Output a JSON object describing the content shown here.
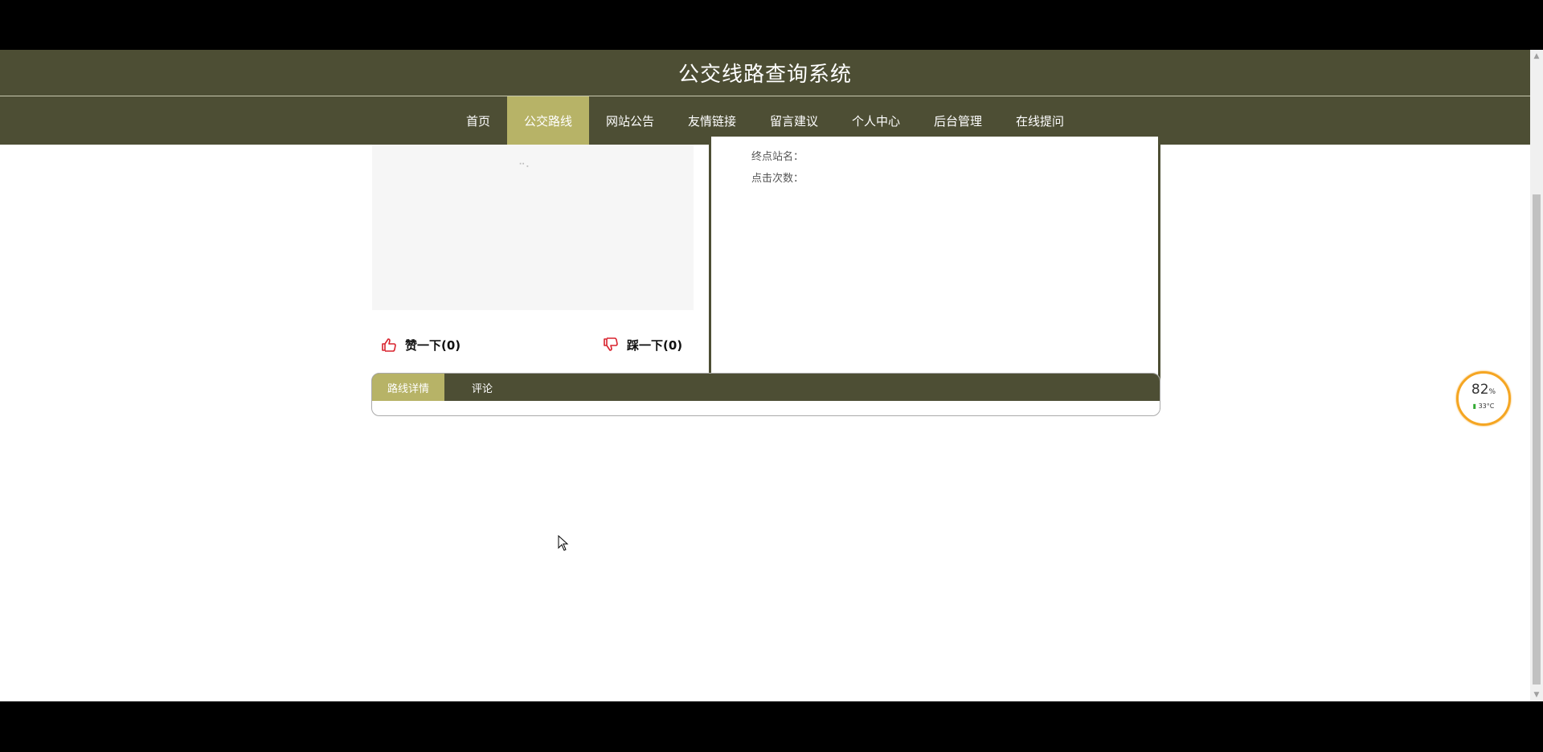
{
  "site": {
    "title": "公交线路查询系统"
  },
  "nav": {
    "items": [
      {
        "label": "首页"
      },
      {
        "label": "公交路线"
      },
      {
        "label": "网站公告"
      },
      {
        "label": "友情链接"
      },
      {
        "label": "留言建议"
      },
      {
        "label": "个人中心"
      },
      {
        "label": "后台管理"
      },
      {
        "label": "在线提问"
      }
    ],
    "active_index": 1
  },
  "votes": {
    "up_label": "赞一下(0)",
    "down_label": "踩一下(0)"
  },
  "info": {
    "end_station_label": "终点站名：",
    "click_count_label": "点击次数："
  },
  "tabs": {
    "items": [
      {
        "label": "路线详情"
      },
      {
        "label": "评论"
      }
    ]
  },
  "battery_widget": {
    "percent": "82",
    "percent_unit": "%",
    "temperature": "33°C"
  },
  "colors": {
    "header_bg": "#4d4e34",
    "accent": "#b7b367",
    "vote_icon": "#d9232e"
  }
}
